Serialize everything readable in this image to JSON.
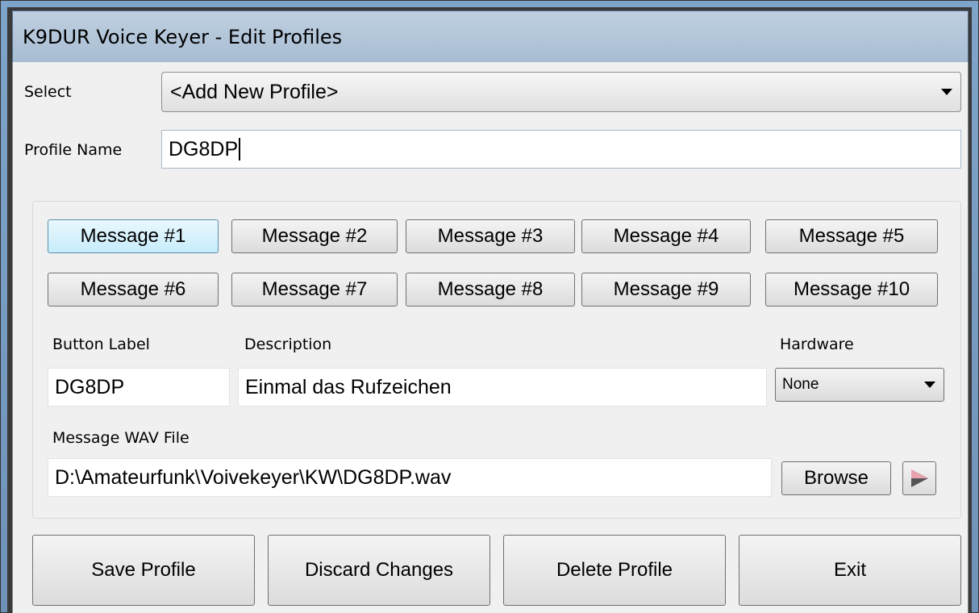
{
  "window": {
    "title": "K9DUR Voice Keyer - Edit Profiles"
  },
  "profile": {
    "select_label": "Select",
    "select_value": "<Add New Profile>",
    "name_label": "Profile Name",
    "name_value": "DG8DP"
  },
  "messages": {
    "row1": [
      "Message #1",
      "Message #2",
      "Message #3",
      "Message #4",
      "Message #5"
    ],
    "row2": [
      "Message #6",
      "Message #7",
      "Message #8",
      "Message #9",
      "Message #10"
    ],
    "active_index": 1
  },
  "fields": {
    "button_label_label": "Button Label",
    "button_label_value": "DG8DP",
    "description_label": "Description",
    "description_value": "Einmal das Rufzeichen",
    "hardware_label": "Hardware",
    "hardware_value": "None",
    "wav_label": "Message WAV File",
    "wav_value": "D:\\Amateurfunk\\Voivekeyer\\KW\\DG8DP.wav",
    "browse_label": "Browse"
  },
  "actions": {
    "save": "Save Profile",
    "discard": "Discard Changes",
    "delete": "Delete Profile",
    "exit": "Exit"
  },
  "icons": {
    "play": "play-icon",
    "dropdown": "chevron-down-icon"
  },
  "colors": {
    "active_button": "#c7ecfb",
    "play_icon": "#e0a0a8"
  }
}
